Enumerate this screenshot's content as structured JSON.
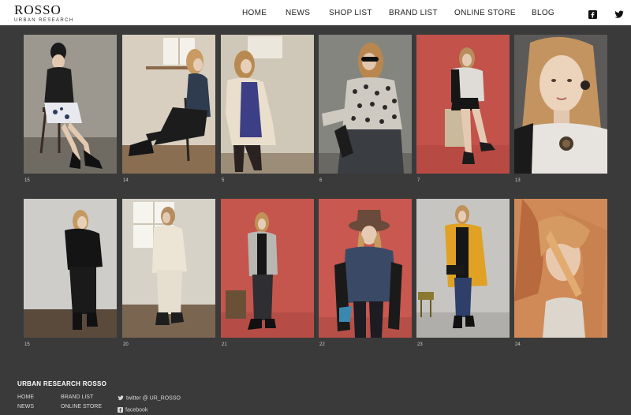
{
  "header": {
    "logo": "ROSSO",
    "logo_sub": "URBAN RESEARCH",
    "nav": [
      {
        "label": "HOME"
      },
      {
        "label": "NEWS"
      },
      {
        "label": "SHOP LIST"
      },
      {
        "label": "BRAND LIST"
      },
      {
        "label": "ONLINE STORE"
      },
      {
        "label": "BLOG"
      }
    ],
    "social": [
      {
        "icon": "facebook-icon"
      },
      {
        "icon": "twitter-icon"
      }
    ]
  },
  "gallery": {
    "row1": [
      {
        "caption": "15"
      },
      {
        "caption": "14"
      },
      {
        "caption": "5"
      },
      {
        "caption": "6"
      },
      {
        "caption": "7"
      },
      {
        "caption": "13"
      }
    ],
    "row2": [
      {
        "caption": "15"
      },
      {
        "caption": "20"
      },
      {
        "caption": "21"
      },
      {
        "caption": "22"
      },
      {
        "caption": "23"
      },
      {
        "caption": "24"
      }
    ]
  },
  "footer": {
    "title": "URBAN RESEARCH ROSSO",
    "col1": [
      "HOME",
      "NEWS"
    ],
    "col2": [
      "BRAND LIST",
      "ONLINE STORE"
    ],
    "twitter": "twitter @ UR_ROSSO",
    "facebook": "facebook"
  },
  "colors": {
    "page_bg": "#3a3a3a",
    "header_bg": "#ffffff",
    "accent_red": "#c2524a"
  }
}
